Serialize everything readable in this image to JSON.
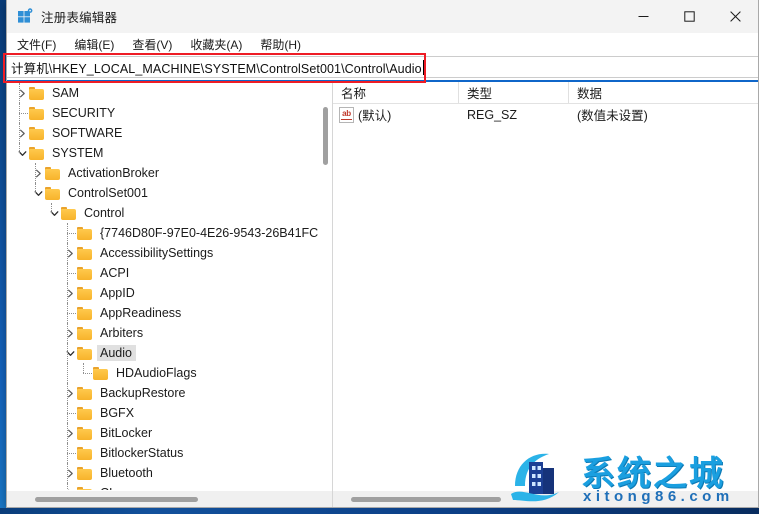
{
  "window": {
    "title": "注册表编辑器",
    "icon": "registry-editor-icon",
    "controls": {
      "minimize": "—",
      "maximize": "☐",
      "close": "✕"
    }
  },
  "menubar": {
    "items": [
      {
        "label": "文件(F)",
        "name": "menu-file"
      },
      {
        "label": "编辑(E)",
        "name": "menu-edit"
      },
      {
        "label": "查看(V)",
        "name": "menu-view"
      },
      {
        "label": "收藏夹(A)",
        "name": "menu-favorites"
      },
      {
        "label": "帮助(H)",
        "name": "menu-help"
      }
    ]
  },
  "address": {
    "value": "计算机\\HKEY_LOCAL_MACHINE\\SYSTEM\\ControlSet001\\Control\\Audio",
    "placeholder": "",
    "caret_visible": true,
    "annotation_color": "#ee1c25"
  },
  "tree": {
    "selected": "Audio",
    "items": [
      {
        "label": "SAM",
        "depth": 1,
        "chevron": "collapsed",
        "selected": false
      },
      {
        "label": "SECURITY",
        "depth": 1,
        "chevron": "none",
        "selected": false
      },
      {
        "label": "SOFTWARE",
        "depth": 1,
        "chevron": "collapsed",
        "selected": false
      },
      {
        "label": "SYSTEM",
        "depth": 1,
        "chevron": "expanded",
        "selected": false
      },
      {
        "label": "ActivationBroker",
        "depth": 2,
        "chevron": "collapsed",
        "selected": false
      },
      {
        "label": "ControlSet001",
        "depth": 2,
        "chevron": "expanded",
        "selected": false
      },
      {
        "label": "Control",
        "depth": 3,
        "chevron": "expanded",
        "selected": false
      },
      {
        "label": "{7746D80F-97E0-4E26-9543-26B41FC",
        "depth": 4,
        "chevron": "none",
        "selected": false
      },
      {
        "label": "AccessibilitySettings",
        "depth": 4,
        "chevron": "collapsed",
        "selected": false
      },
      {
        "label": "ACPI",
        "depth": 4,
        "chevron": "none",
        "selected": false
      },
      {
        "label": "AppID",
        "depth": 4,
        "chevron": "collapsed",
        "selected": false
      },
      {
        "label": "AppReadiness",
        "depth": 4,
        "chevron": "none",
        "selected": false
      },
      {
        "label": "Arbiters",
        "depth": 4,
        "chevron": "collapsed",
        "selected": false
      },
      {
        "label": "Audio",
        "depth": 4,
        "chevron": "expanded",
        "selected": true
      },
      {
        "label": "HDAudioFlags",
        "depth": 5,
        "chevron": "none",
        "selected": false
      },
      {
        "label": "BackupRestore",
        "depth": 4,
        "chevron": "collapsed",
        "selected": false
      },
      {
        "label": "BGFX",
        "depth": 4,
        "chevron": "none",
        "selected": false
      },
      {
        "label": "BitLocker",
        "depth": 4,
        "chevron": "collapsed",
        "selected": false
      },
      {
        "label": "BitlockerStatus",
        "depth": 4,
        "chevron": "none",
        "selected": false
      },
      {
        "label": "Bluetooth",
        "depth": 4,
        "chevron": "collapsed",
        "selected": false
      },
      {
        "label": "CI",
        "depth": 4,
        "chevron": "collapsed",
        "selected": false
      }
    ]
  },
  "list": {
    "columns": [
      {
        "label": "名称",
        "name": "column-name"
      },
      {
        "label": "类型",
        "name": "column-type"
      },
      {
        "label": "数据",
        "name": "column-data"
      }
    ],
    "rows": [
      {
        "icon": "string-value-icon",
        "name": "(默认)",
        "type": "REG_SZ",
        "data": "(数值未设置)"
      }
    ]
  },
  "watermark": {
    "title": "系统之城",
    "subtitle": "xitong86.com",
    "color": "#1a9fe0"
  }
}
